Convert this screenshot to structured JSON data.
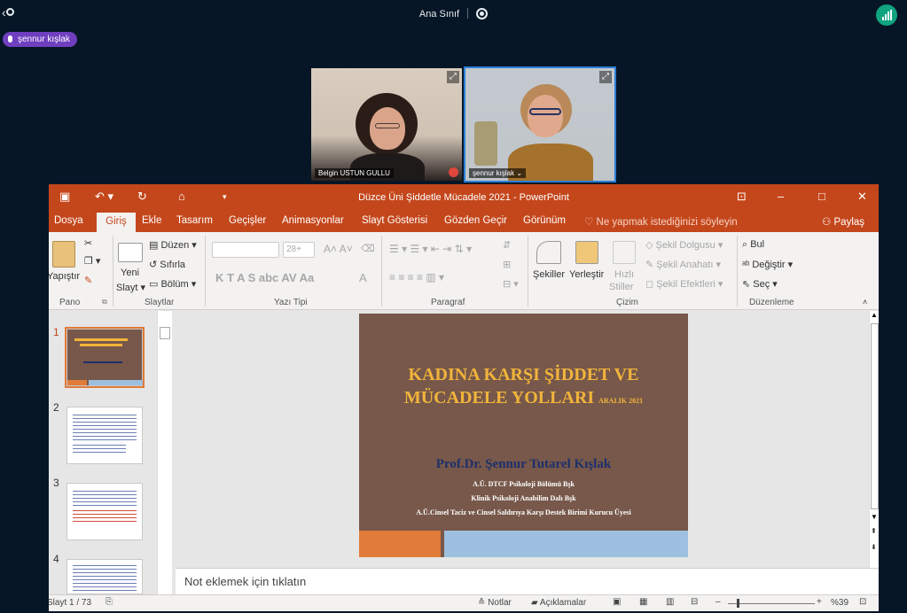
{
  "meeting": {
    "title": "Ana Sınıf",
    "active_speaker": "şennur kışlak"
  },
  "participants": [
    {
      "name": "Belgin USTUN GULLU"
    },
    {
      "name": "şennur kışlak"
    }
  ],
  "ppt": {
    "window_title": "Düzce Üni Şiddetle Mücadele  2021 - PowerPoint",
    "share_label": "Paylaş",
    "tabs": [
      "Dosya",
      "Giriş",
      "Ekle",
      "Tasarım",
      "Geçişler",
      "Animasyonlar",
      "Slayt Gösterisi",
      "Gözden Geçir",
      "Görünüm"
    ],
    "tell_me": "Ne yapmak istediğinizi söyleyin",
    "ribbon": {
      "paste": "Yapıştır",
      "new_slide_1": "Yeni",
      "new_slide_2": "Slayt",
      "layout": "Düzen",
      "reset": "Sıfırla",
      "section": "Bölüm",
      "font_size": "28+",
      "font_buttons": "K  T  A  S  abc  AV  Aa",
      "shapes": "Şekiller",
      "arrange": "Yerleştir",
      "quick_styles_1": "Hızlı",
      "quick_styles_2": "Stiller",
      "shape_fill": "Şekil Dolgusu",
      "shape_outline": "Şekil Anahatı",
      "shape_effects": "Şekil Efektleri",
      "find": "Bul",
      "replace": "Değiştir",
      "select": "Seç",
      "groups": {
        "clipboard": "Pano",
        "slides": "Slaytlar",
        "font": "Yazı Tipi",
        "paragraph": "Paragraf",
        "drawing": "Çizim",
        "editing": "Düzenleme"
      }
    },
    "thumbnails": [
      "1",
      "2",
      "3",
      "4"
    ],
    "slide": {
      "title_line1": "KADINA KARŞI ŞİDDET VE",
      "title_line2": "MÜCADELE YOLLARI",
      "date": "ARALIK 2021",
      "author": "Prof.Dr. Şennur Tutarel Kışlak",
      "line1": "A.Ü. DTCF Psikoloji Bölümü Bşk",
      "line2": "Klinik Psikoloji Anabilim Dalı Bşk",
      "line3": "A.Ü.Cinsel Taciz ve Cinsel Saldırıya Karşı Destek Birimi Kurucu Üyesi"
    },
    "notes_placeholder": "Not eklemek için tıklatın",
    "status": {
      "slide_counter": "Slayt 1 / 73",
      "notes": "Notlar",
      "comments": "Açıklamalar",
      "zoom": "%39"
    }
  },
  "colors": {
    "ppt_accent": "#c4471c",
    "slide_bg": "#77584a",
    "slide_title": "#f2b43b",
    "speaker_pill": "#6f3fbf",
    "signal": "#0fa37f"
  }
}
